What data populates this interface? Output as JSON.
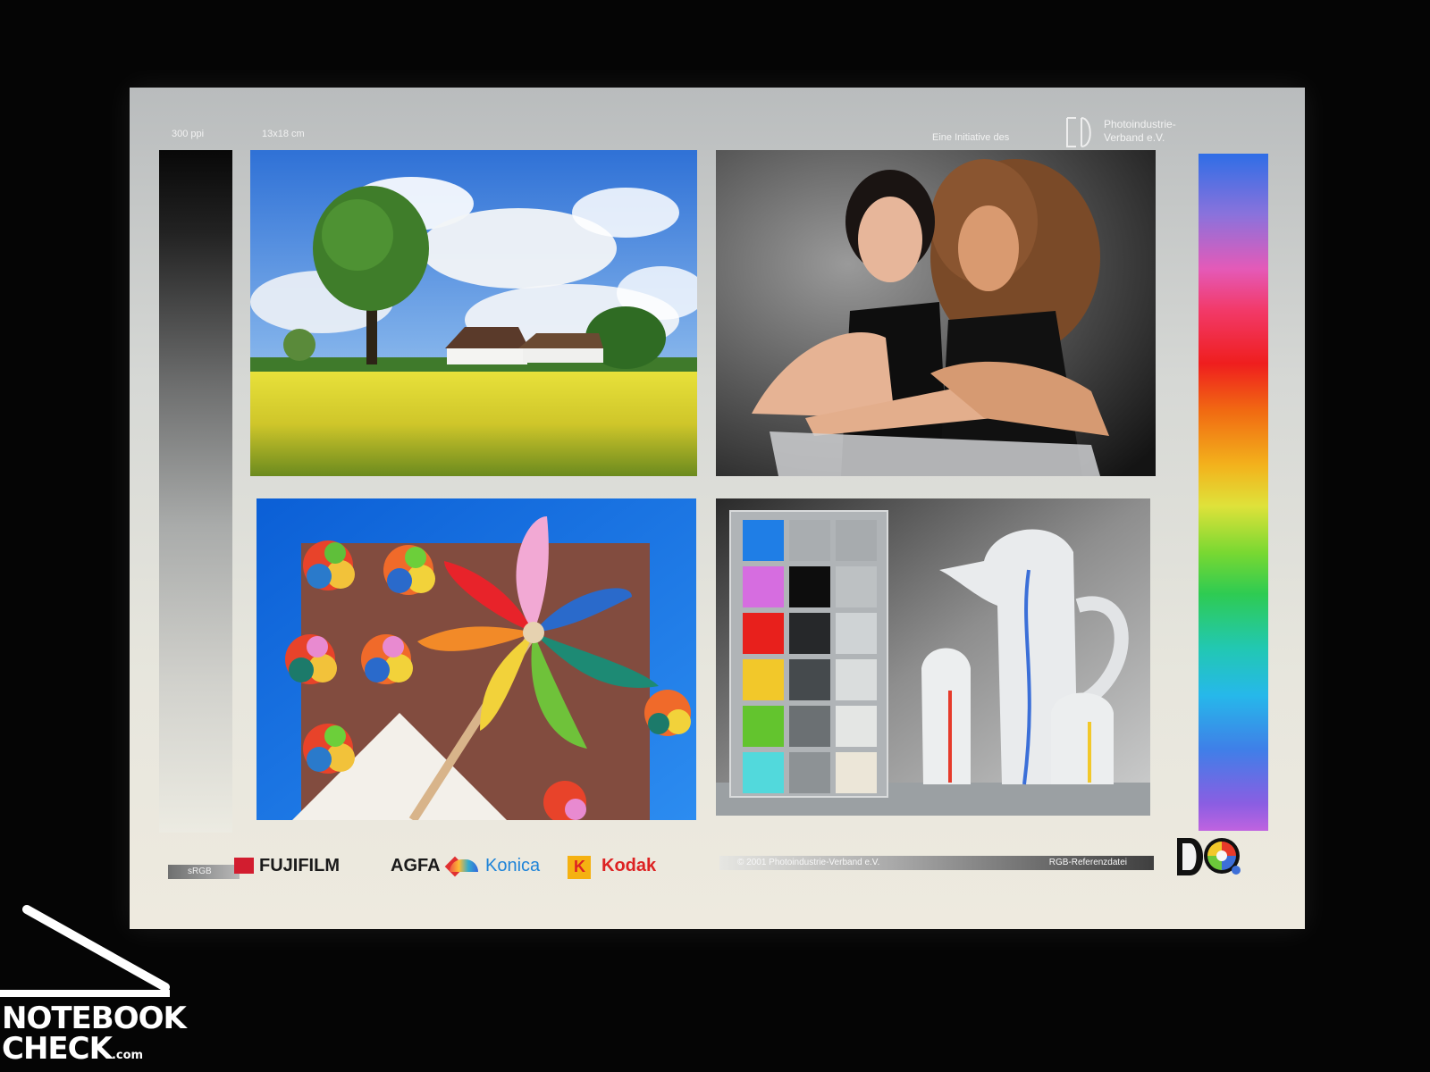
{
  "header": {
    "resolution": "300 ppi",
    "print_size": "13x18 cm",
    "initiative": "Eine Initiative des",
    "org_line1": "Photoindustrie-",
    "org_line2": "Verband e.V."
  },
  "footer": {
    "color_space": "sRGB",
    "brands": [
      "FUJIFILM",
      "AGFA",
      "Konica",
      "Kodak"
    ],
    "copyright": "© 2001 Photoindustrie-Verband e.V.",
    "file_label": "RGB-Referenzdatei"
  },
  "watermark": {
    "line1": "NOTEBOOK",
    "line2": "CHECK",
    "suffix": ".com"
  },
  "colors": {
    "background": "#050505",
    "chart_blue": "#1f7ee6",
    "chart_magenta": "#d66de0",
    "chart_red": "#e8201c",
    "chart_yellow": "#f2c82a",
    "chart_green": "#63c42e",
    "chart_cyan": "#52d9dc"
  },
  "photos": [
    "landscape-photo",
    "portrait-photo",
    "pinwheel-photo",
    "color-chart-photo"
  ]
}
